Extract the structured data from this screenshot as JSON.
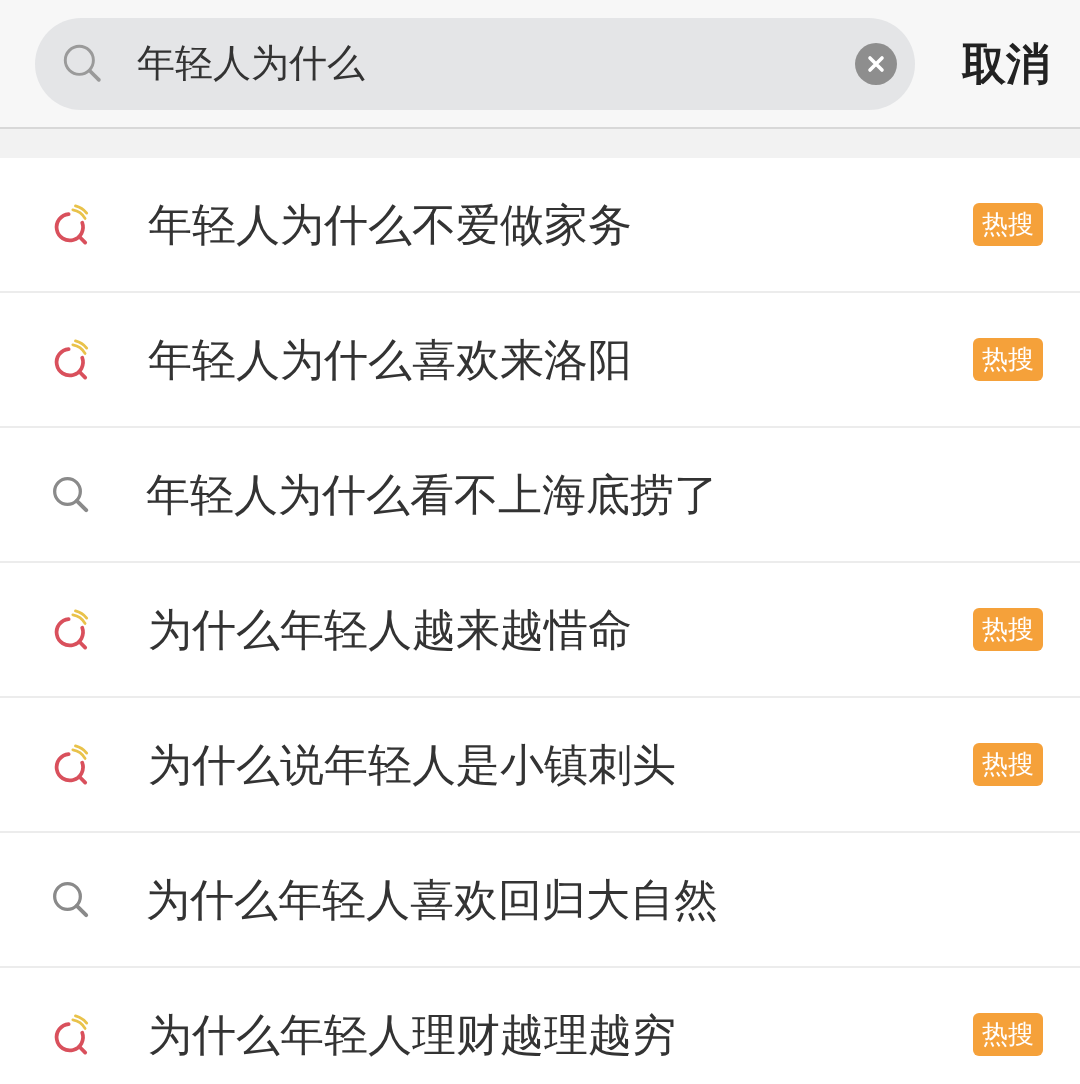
{
  "search": {
    "value": "年轻人为什么"
  },
  "cancel": "取消",
  "suggestions": [
    {
      "text": "年轻人为什么不爱做家务",
      "kind": "hot",
      "badge": "热搜"
    },
    {
      "text": "年轻人为什么喜欢来洛阳",
      "kind": "hot",
      "badge": "热搜"
    },
    {
      "text": "年轻人为什么看不上海底捞了",
      "kind": "plain"
    },
    {
      "text": "为什么年轻人越来越惜命",
      "kind": "hot",
      "badge": "热搜"
    },
    {
      "text": "为什么说年轻人是小镇刺头",
      "kind": "hot",
      "badge": "热搜"
    },
    {
      "text": "为什么年轻人喜欢回归大自然",
      "kind": "plain"
    },
    {
      "text": "为什么年轻人理财越理越穷",
      "kind": "hot",
      "badge": "热搜"
    }
  ]
}
